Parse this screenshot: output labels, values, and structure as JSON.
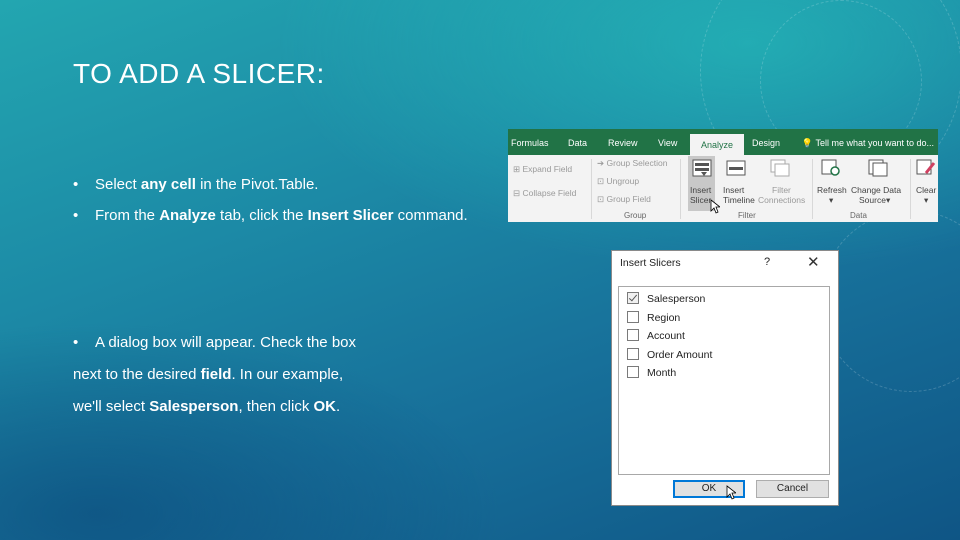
{
  "slide": {
    "title": "TO ADD A SLICER:",
    "bullets": [
      {
        "marker": "•",
        "parts": [
          "Select ",
          "any cell",
          " in the Pivot.Table."
        ]
      },
      {
        "marker": "•",
        "parts": [
          "From the ",
          "Analyze",
          " tab, click the ",
          "Insert Slicer",
          " command."
        ]
      },
      {
        "marker": "•",
        "line1": "A dialog box will appear. Check the box",
        "line2_parts": [
          "next to the desired ",
          "field",
          ". In our example,"
        ],
        "line3_parts": [
          "we'll select ",
          "Salesperson",
          ", then click ",
          "OK",
          "."
        ]
      }
    ]
  },
  "ribbon": {
    "tabs": [
      "Formulas",
      "Data",
      "Review",
      "View",
      "Analyze",
      "Design"
    ],
    "active_tab": "Analyze",
    "tell_me": "Tell me what you want to do...",
    "active_field_items": [
      "Expand Field",
      "Collapse Field"
    ],
    "group_items": [
      "Group Selection",
      "Ungroup",
      "Group Field"
    ],
    "group_label": "Group",
    "filter_buttons": {
      "insert_slicer": [
        "Insert",
        "Slicer"
      ],
      "insert_timeline": [
        "Insert",
        "Timeline"
      ],
      "filter_connections": [
        "Filter",
        "Connections"
      ]
    },
    "filter_label": "Filter",
    "data_buttons": {
      "refresh": "Refresh",
      "change_data_source": [
        "Change Data",
        "Source"
      ]
    },
    "data_label": "Data",
    "clear": "Clear",
    "accent_color": "#217346"
  },
  "dialog": {
    "title": "Insert Slicers",
    "help": "?",
    "close": "✕",
    "fields": [
      {
        "label": "Salesperson",
        "checked": true
      },
      {
        "label": "Region",
        "checked": false
      },
      {
        "label": "Account",
        "checked": false
      },
      {
        "label": "Order Amount",
        "checked": false
      },
      {
        "label": "Month",
        "checked": false
      }
    ],
    "ok_label": "OK",
    "cancel_label": "Cancel"
  }
}
